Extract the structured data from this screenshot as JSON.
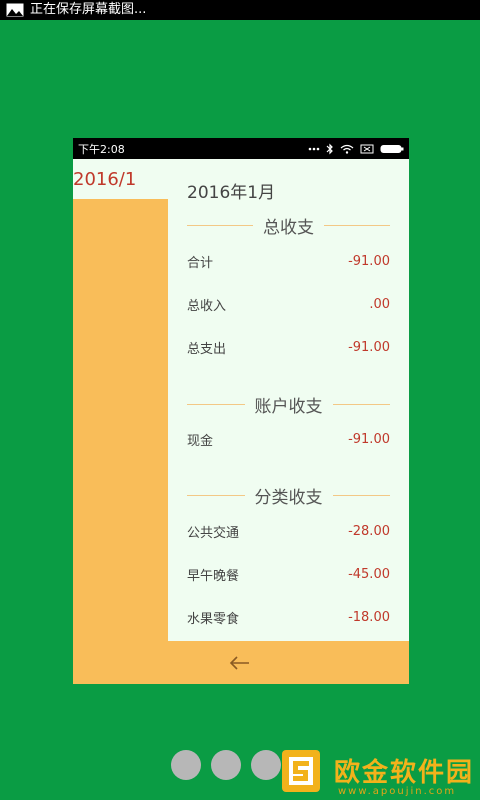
{
  "outer_status": {
    "icon": "picture-icon",
    "text": "正在保存屏幕截图..."
  },
  "inner_status": {
    "time": "下午2:08",
    "icons": [
      "dots-icon",
      "bluetooth-icon",
      "wifi-icon",
      "no-sim-icon",
      "battery-icon"
    ]
  },
  "sidebar": {
    "date": "2016/1"
  },
  "report": {
    "month": "2016年1月",
    "sections": [
      {
        "title": "总收支",
        "rows": [
          {
            "name": "合计",
            "amount": "-91.00"
          },
          {
            "name": "总收入",
            "amount": ".00"
          },
          {
            "name": "总支出",
            "amount": "-91.00"
          }
        ]
      },
      {
        "title": "账户收支",
        "rows": [
          {
            "name": "现金",
            "amount": "-91.00"
          }
        ]
      },
      {
        "title": "分类收支",
        "rows": [
          {
            "name": "公共交通",
            "amount": "-28.00"
          },
          {
            "name": "早午晚餐",
            "amount": "-45.00"
          },
          {
            "name": "水果零食",
            "amount": "-18.00"
          }
        ]
      }
    ]
  },
  "back_icon": "back-arrow-icon",
  "page_dots": 4,
  "watermark": {
    "text": "欧金软件园",
    "url": "www.apoujin.com"
  },
  "colors": {
    "background": "#0a9c44",
    "panel": "#f0fdf1",
    "accent_orange": "#f9bd59",
    "amount_red": "#c0392b"
  }
}
